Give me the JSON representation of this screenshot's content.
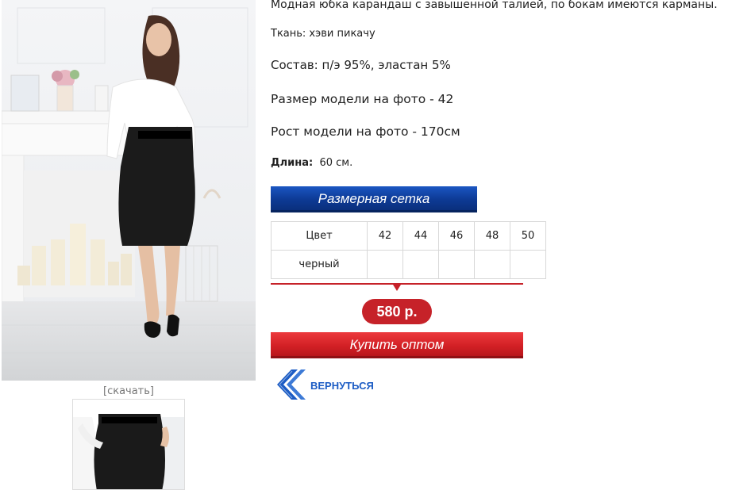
{
  "product": {
    "download_label": "[скачать]",
    "description": {
      "line1": "Модная юбка карандаш с завышенной талией, по бокам имеются карманы.",
      "line2": "Ткань: хэви пикачу",
      "line3": "Состав: п/э 95%, эластан 5%",
      "line4": "Размер модели на фото - 42",
      "line5": "Рост модели на фото - 170см",
      "length_label": "Длина:",
      "length_value": "60 см."
    },
    "size_grid_button": "Размерная сетка",
    "size_table": {
      "header": [
        "Цвет",
        "42",
        "44",
        "46",
        "48",
        "50"
      ],
      "rows": [
        [
          "черный",
          "",
          "",
          "",
          "",
          ""
        ]
      ]
    },
    "price": "580 р.",
    "buy_button": "Купить оптом",
    "back_link": "ВЕРНУТЬСЯ"
  },
  "colors": {
    "accent_red": "#c62229",
    "accent_blue": "#0d3a95",
    "link_blue": "#1c5cc4"
  }
}
